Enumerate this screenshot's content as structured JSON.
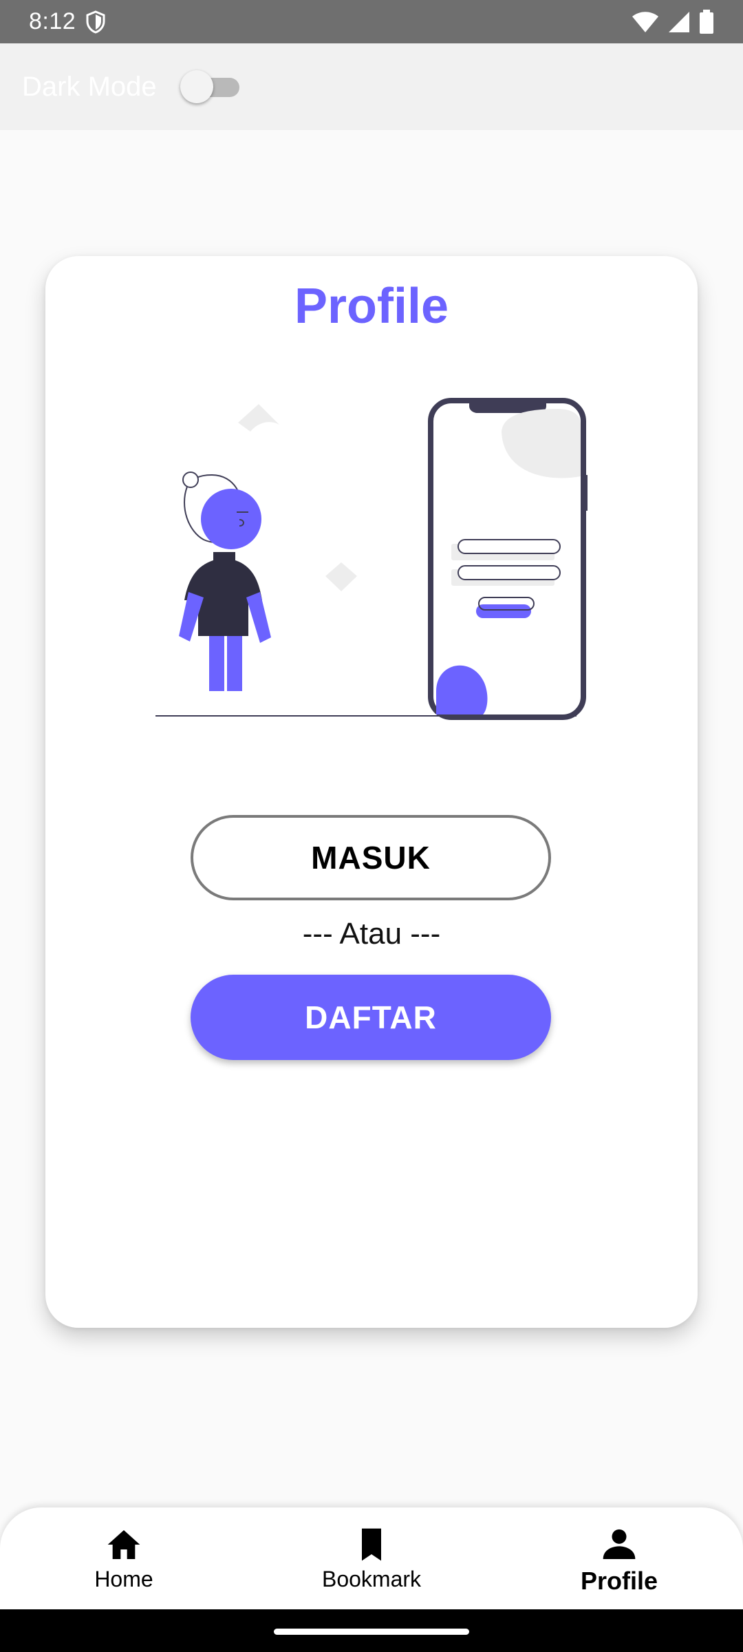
{
  "status_bar": {
    "time": "8:12",
    "icons": [
      "shield-icon",
      "wifi-icon",
      "signal-icon",
      "battery-icon"
    ]
  },
  "top_bar": {
    "dark_mode_label": "Dark Mode",
    "dark_mode_enabled": false
  },
  "card": {
    "title": "Profile",
    "illustration": "person-with-phone-login-illustration",
    "login_button_label": "MASUK",
    "separator_text": "--- Atau ---",
    "register_button_label": "DAFTAR"
  },
  "bottom_nav": {
    "active": "Profile",
    "items": [
      {
        "label": "Home",
        "icon": "home-icon"
      },
      {
        "label": "Bookmark",
        "icon": "bookmark-icon"
      },
      {
        "label": "Profile",
        "icon": "person-icon"
      }
    ]
  },
  "colors": {
    "accent": "#6c63ff",
    "status_bar": "#6f6f6f",
    "background": "#fafafa",
    "card": "#ffffff"
  }
}
